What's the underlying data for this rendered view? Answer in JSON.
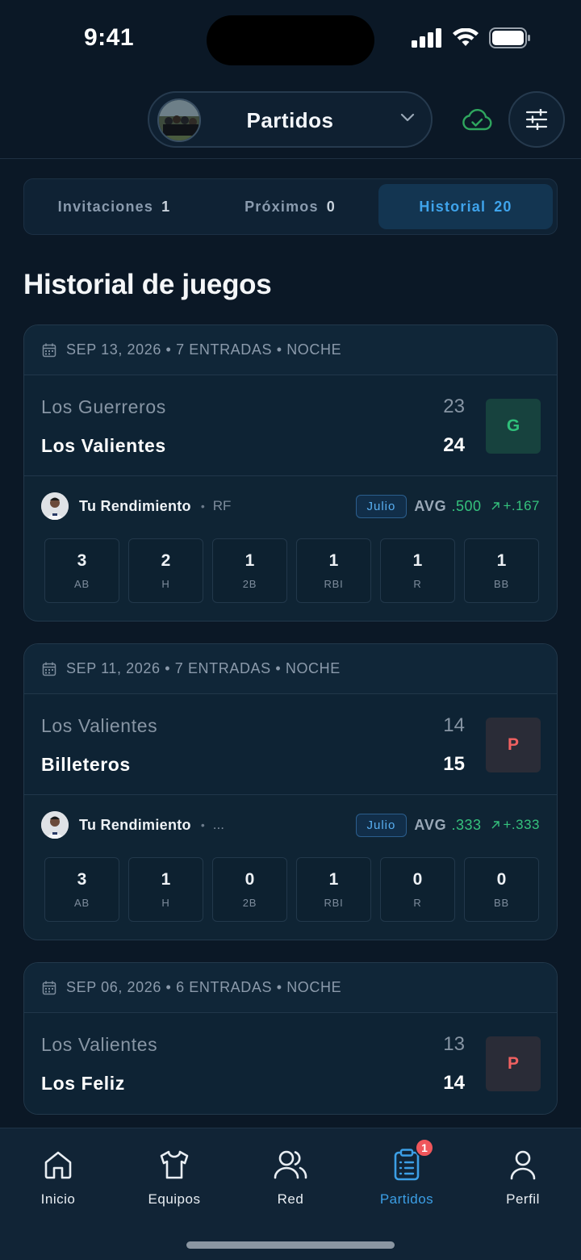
{
  "status_bar": {
    "time": "9:41"
  },
  "header": {
    "title": "Partidos"
  },
  "tabs": [
    {
      "label": "Invitaciones",
      "count": "1"
    },
    {
      "label": "Próximos",
      "count": "0"
    },
    {
      "label": "Historial",
      "count": "20"
    }
  ],
  "section_title": "Historial de juegos",
  "games": [
    {
      "date": "SEP 13, 2026 • 7 ENTRADAS • NOCHE",
      "team1": "Los Guerreros",
      "runs1": "23",
      "team2": "Los Valientes",
      "runs2": "24",
      "result": "G",
      "perf_label": "Tu Rendimiento",
      "position": "RF",
      "month": "Julio",
      "avg_label": "AVG",
      "avg_value": ".500",
      "avg_delta": "+.167",
      "stats": [
        {
          "value": "3",
          "label": "AB"
        },
        {
          "value": "2",
          "label": "H"
        },
        {
          "value": "1",
          "label": "2B"
        },
        {
          "value": "1",
          "label": "RBI"
        },
        {
          "value": "1",
          "label": "R"
        },
        {
          "value": "1",
          "label": "BB"
        }
      ]
    },
    {
      "date": "SEP 11, 2026 • 7 ENTRADAS • NOCHE",
      "team1": "Los Valientes",
      "runs1": "14",
      "team2": "Billeteros",
      "runs2": "15",
      "result": "P",
      "perf_label": "Tu Rendimiento",
      "position": "...",
      "month": "Julio",
      "avg_label": "AVG",
      "avg_value": ".333",
      "avg_delta": "+.333",
      "stats": [
        {
          "value": "3",
          "label": "AB"
        },
        {
          "value": "1",
          "label": "H"
        },
        {
          "value": "0",
          "label": "2B"
        },
        {
          "value": "1",
          "label": "RBI"
        },
        {
          "value": "0",
          "label": "R"
        },
        {
          "value": "0",
          "label": "BB"
        }
      ]
    },
    {
      "date": "SEP 06, 2026 • 6 ENTRADAS • NOCHE",
      "team1": "Los Valientes",
      "runs1": "13",
      "team2": "Los Feliz",
      "runs2": "14",
      "result": "P"
    }
  ],
  "bottom_nav": [
    {
      "label": "Inicio",
      "icon": "home-icon"
    },
    {
      "label": "Equipos",
      "icon": "shirt-icon"
    },
    {
      "label": "Red",
      "icon": "users-icon"
    },
    {
      "label": "Partidos",
      "icon": "clipboard-list-icon",
      "badge": "1"
    },
    {
      "label": "Perfil",
      "icon": "user-icon"
    }
  ],
  "colors": {
    "accent": "#3c9fe6",
    "win": "#2fbf7a",
    "loss": "#f06161",
    "background": "#0b1826"
  }
}
